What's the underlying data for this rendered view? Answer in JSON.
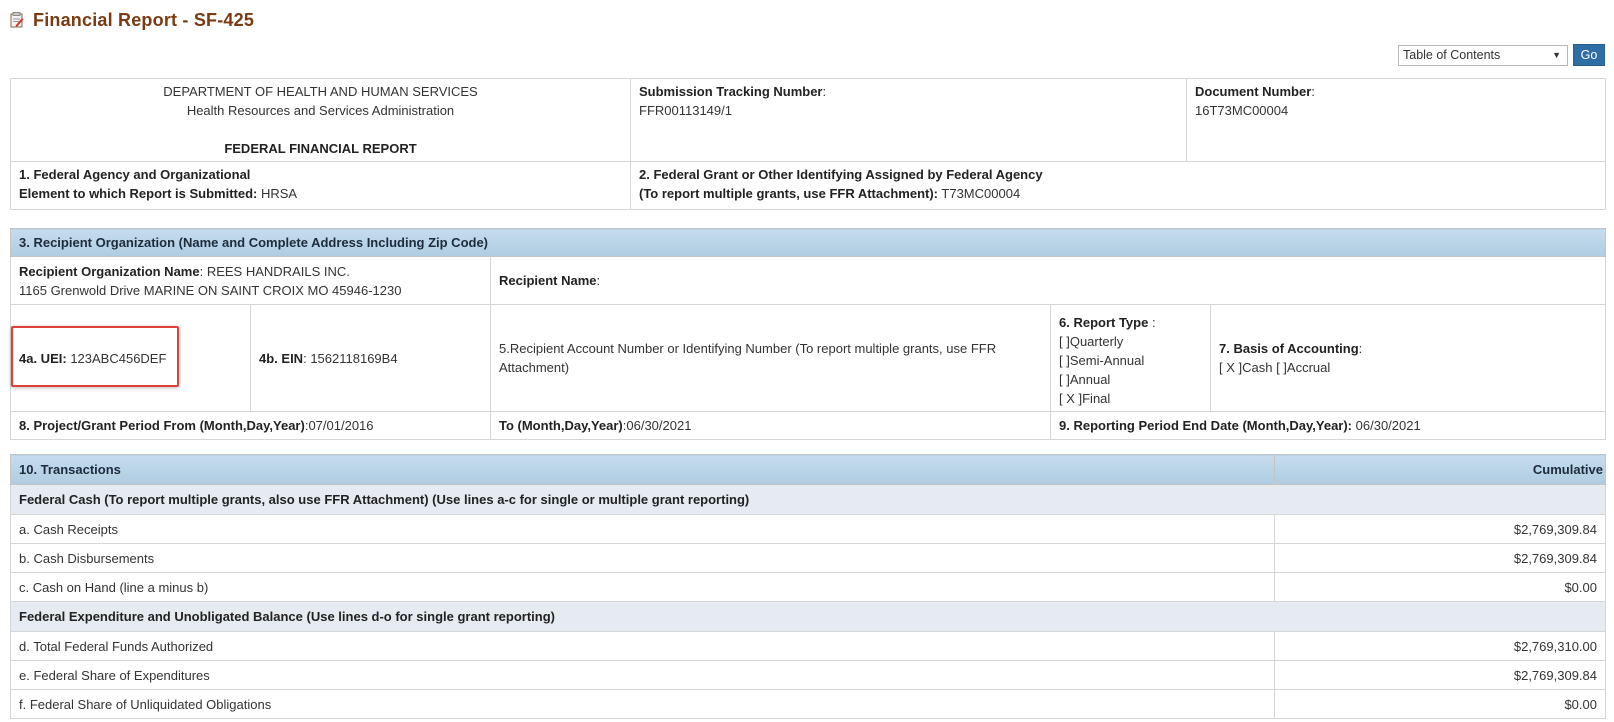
{
  "page": {
    "title": "Financial Report - SF-425"
  },
  "toolbar": {
    "toc_selected": "Table of Contents",
    "go_label": "Go"
  },
  "header": {
    "dept_line1": "DEPARTMENT OF HEALTH AND HUMAN SERVICES",
    "dept_line2": "Health Resources and Services Administration",
    "report_name": "FEDERAL FINANCIAL REPORT",
    "tracking_label": "Submission Tracking Number",
    "tracking_value": "FFR00113149/1",
    "docnum_label": "Document Number",
    "docnum_value": "16T73MC00004",
    "agency_label_1": "1. Federal Agency and Organizational",
    "agency_label_2": "Element to which Report is Submitted:",
    "agency_value": "HRSA",
    "grant_label_1": "2. Federal Grant or Other Identifying Assigned by Federal Agency",
    "grant_label_2": "(To report multiple grants, use FFR Attachment):",
    "grant_value": "T73MC00004"
  },
  "recipient": {
    "section_title": "3. Recipient Organization (Name and Complete Address Including Zip Code)",
    "org_name_label": "Recipient Organization Name",
    "org_name_value": "REES HANDRAILS INC.",
    "org_address": "1165 Grenwold Drive MARINE ON SAINT CROIX MO 45946-1230",
    "recipient_name_label": "Recipient Name",
    "uei_label": "4a. UEI:",
    "uei_value": "123ABC456DEF",
    "ein_label": "4b. EIN",
    "ein_value": "1562118169B4",
    "account_text": "5.Recipient Account Number or Identifying Number (To report multiple grants, use FFR Attachment)",
    "report_type_label": "6. Report Type",
    "report_type_options": [
      "[  ]Quarterly",
      "[  ]Semi-Annual",
      "[  ]Annual",
      "[ X ]Final"
    ],
    "basis_label": "7. Basis of Accounting",
    "basis_value": "[ X ]Cash [  ]Accrual",
    "period_from_label": "8. Project/Grant Period From (Month,Day,Year)",
    "period_from_value": "07/01/2016",
    "period_to_label": "To (Month,Day,Year)",
    "period_to_value": "06/30/2021",
    "reporting_end_label": "9. Reporting Period End Date (Month,Day,Year):",
    "reporting_end_value": "06/30/2021"
  },
  "transactions": {
    "section_title": "10. Transactions",
    "cumulative_label": "Cumulative",
    "group1_title": "Federal Cash (To report multiple grants, also use FFR Attachment) (Use lines a-c for single or multiple grant reporting)",
    "group1_rows": [
      {
        "label": "a. Cash Receipts",
        "amount": "$2,769,309.84"
      },
      {
        "label": "b. Cash Disbursements",
        "amount": "$2,769,309.84"
      },
      {
        "label": "c. Cash on Hand (line a minus b)",
        "amount": "$0.00"
      }
    ],
    "group2_title": "Federal Expenditure and Unobligated Balance (Use lines d-o for single grant reporting)",
    "group2_rows": [
      {
        "label": "d. Total Federal Funds Authorized",
        "amount": "$2,769,310.00"
      },
      {
        "label": "e. Federal Share of Expenditures",
        "amount": "$2,769,309.84"
      },
      {
        "label": "f. Federal Share of Unliquidated Obligations",
        "amount": "$0.00"
      }
    ]
  }
}
